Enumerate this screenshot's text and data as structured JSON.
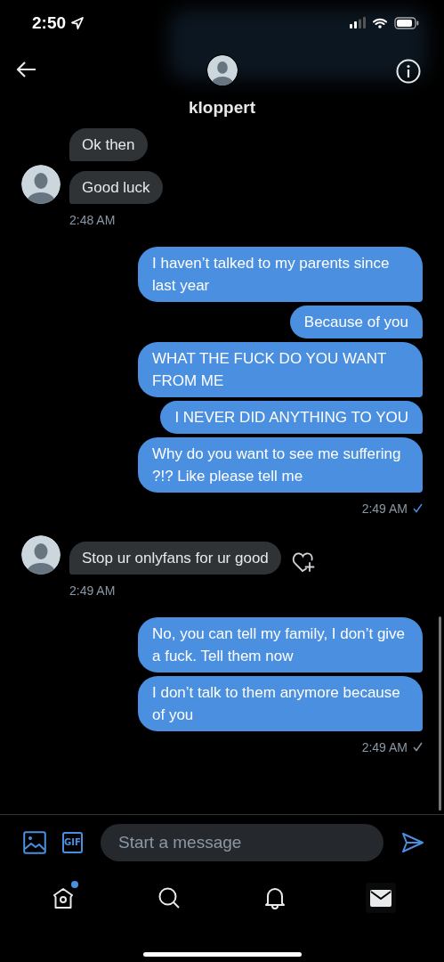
{
  "status_bar": {
    "time": "2:50"
  },
  "header": {
    "name": "kloppert"
  },
  "messages": [
    {
      "kind": "incoming",
      "text": "Ok then",
      "avatar": false,
      "react": false
    },
    {
      "kind": "incoming",
      "text": "Good luck",
      "avatar": true,
      "react": false
    },
    {
      "kind": "incoming_time",
      "text": "2:48 AM"
    },
    {
      "kind": "outgoing",
      "text": "I haven’t talked to my parents since last year"
    },
    {
      "kind": "outgoing",
      "text": "Because of you"
    },
    {
      "kind": "outgoing",
      "text": "WHAT THE FUCK DO YOU WANT FROM ME"
    },
    {
      "kind": "outgoing",
      "text": "I NEVER DID ANYTHING TO YOU"
    },
    {
      "kind": "outgoing",
      "text": "Why do you want to see me suffering ?!? Like please tell me"
    },
    {
      "kind": "outgoing_time",
      "text": "2:49 AM",
      "read": true
    },
    {
      "kind": "incoming",
      "text": "Stop ur onlyfans for ur good",
      "avatar": true,
      "react": true
    },
    {
      "kind": "incoming_time",
      "text": "2:49 AM"
    },
    {
      "kind": "outgoing",
      "text": "No, you can tell my family, I don’t give a fuck. Tell them now"
    },
    {
      "kind": "outgoing",
      "text": "I don’t talk to them anymore because of you"
    },
    {
      "kind": "outgoing_time",
      "text": "2:49 AM",
      "read": false
    }
  ],
  "composer": {
    "gif_label": "GIF",
    "placeholder": "Start a message"
  },
  "tabs": [
    {
      "kind": "home",
      "selected": false,
      "badge": true
    },
    {
      "kind": "search",
      "selected": false,
      "badge": false
    },
    {
      "kind": "notifications",
      "selected": false,
      "badge": false
    },
    {
      "kind": "messages",
      "selected": true,
      "badge": false
    }
  ]
}
